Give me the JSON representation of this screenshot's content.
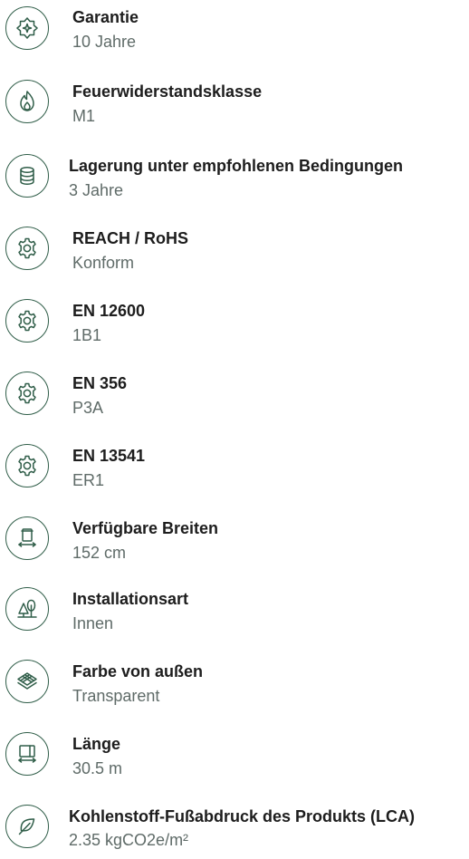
{
  "specs": [
    {
      "label": "Garantie",
      "value": "10 Jahre",
      "icon": "award-icon"
    },
    {
      "label": "Feuerwiderstandsklasse",
      "value": "M1",
      "icon": "flame-icon"
    },
    {
      "label": "Lagerung unter empfohlenen Bedingungen",
      "value": "3 Jahre",
      "icon": "database-icon"
    },
    {
      "label": "REACH / RoHS",
      "value": "Konform",
      "icon": "gear-icon"
    },
    {
      "label": "EN 12600",
      "value": "1B1",
      "icon": "gear-icon"
    },
    {
      "label": "EN 356",
      "value": "P3A",
      "icon": "gear-icon"
    },
    {
      "label": "EN 13541",
      "value": "ER1",
      "icon": "gear-icon"
    },
    {
      "label": "Verfügbare Breiten",
      "value": "152 cm",
      "icon": "roll-width-icon"
    },
    {
      "label": "Installationsart",
      "value": "Innen",
      "icon": "trees-icon"
    },
    {
      "label": "Farbe von außen",
      "value": "Transparent",
      "icon": "layers-icon"
    },
    {
      "label": "Länge",
      "value": "30.5 m",
      "icon": "length-icon"
    },
    {
      "label": "Kohlenstoff-Fußabdruck des Produkts (LCA)",
      "value": "2.35 kgCO2e/m²",
      "icon": "leaf-icon"
    }
  ],
  "colors": {
    "icon": "#2f5d48",
    "label": "#1d1d1d",
    "value": "#5f6b68"
  }
}
